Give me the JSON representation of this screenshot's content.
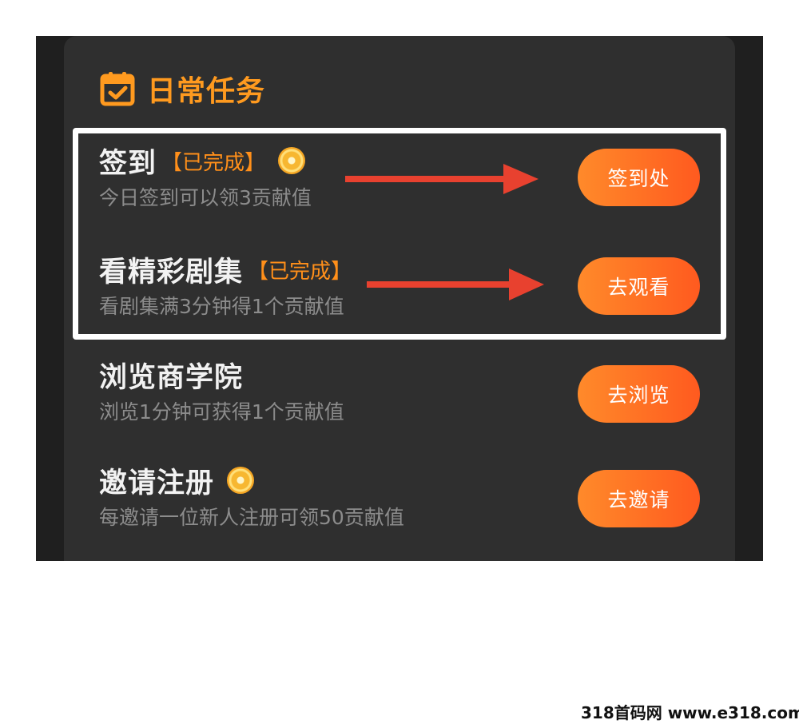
{
  "header": {
    "title": "日常任务",
    "icon": "calendar-check-icon"
  },
  "tasks": [
    {
      "name": "签到",
      "status": "【已完成】",
      "has_coin": true,
      "desc": "今日签到可以领3贡献值",
      "button": "签到处"
    },
    {
      "name": "看精彩剧集",
      "status": "【已完成】",
      "has_coin": false,
      "desc": "看剧集满3分钟得1个贡献值",
      "button": "去观看"
    },
    {
      "name": "浏览商学院",
      "status": "",
      "has_coin": false,
      "desc": "浏览1分钟可获得1个贡献值",
      "button": "去浏览"
    },
    {
      "name": "邀请注册",
      "status": "",
      "has_coin": true,
      "desc": "每邀请一位新人注册可领50贡献值",
      "button": "去邀请"
    }
  ],
  "watermark": "318首码网 www.e318.com",
  "colors": {
    "accent": "#ff9a1f",
    "button_start": "#ff8a2a",
    "button_end": "#ff5a1f",
    "arrow": "#e8412f",
    "card_bg": "#2f2f2f"
  }
}
